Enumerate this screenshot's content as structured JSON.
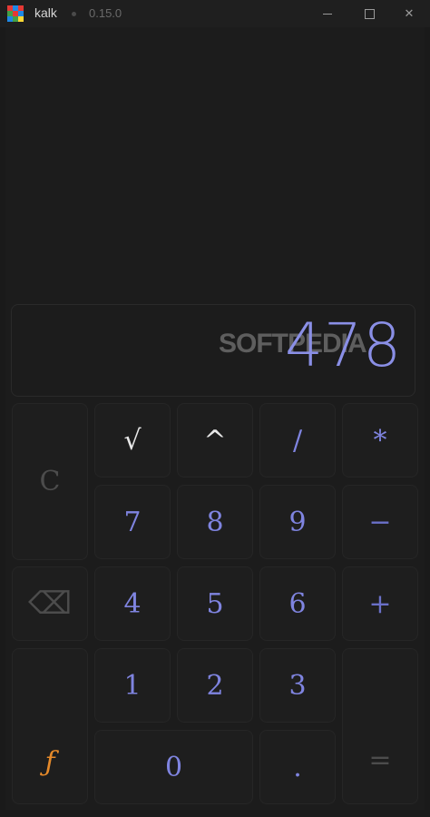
{
  "window": {
    "app_name": "kalk",
    "version": "0.15.0",
    "minimize_glyph": "",
    "maximize_glyph": "",
    "close_glyph": "✕"
  },
  "display": {
    "value": "478",
    "watermark": "SOFTPEDIA"
  },
  "keys": {
    "clear": "C",
    "sqrt": "√",
    "power": "^",
    "divide": "/",
    "multiply": "*",
    "seven": "7",
    "eight": "8",
    "nine": "9",
    "minus": "−",
    "backspace": "⌫",
    "four": "4",
    "five": "5",
    "six": "6",
    "plus": "+",
    "one": "1",
    "two": "2",
    "three": "3",
    "function": "ƒ",
    "zero": "0",
    "decimal": ".",
    "equals": "="
  },
  "colors": {
    "background": "#1a1a1a",
    "accent": "#7f84e0",
    "function": "#e68a2a",
    "operator_white": "#e8e8e8"
  }
}
